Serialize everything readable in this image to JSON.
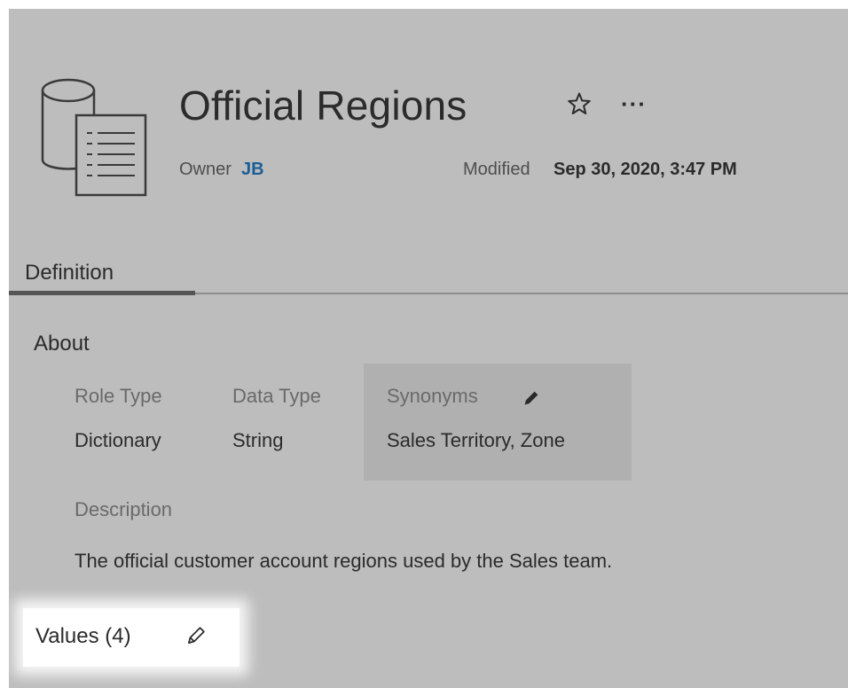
{
  "header": {
    "title": "Official Regions",
    "owner_label": "Owner",
    "owner_value": "JB",
    "modified_label": "Modified",
    "modified_value": "Sep 30, 2020, 3:47 PM",
    "icons": [
      "database-table-icon",
      "star-icon",
      "more-options-icon"
    ]
  },
  "tabs": [
    {
      "label": "Definition",
      "selected": true
    }
  ],
  "about": {
    "heading": "About",
    "role_type": {
      "label": "Role Type",
      "value": "Dictionary"
    },
    "data_type": {
      "label": "Data Type",
      "value": "String"
    },
    "synonyms": {
      "label": "Synonyms",
      "value": "Sales Territory, Zone",
      "edit_icon": "pencil-icon"
    },
    "description": {
      "label": "Description",
      "value": "The official customer account regions used by the Sales team."
    }
  },
  "values": {
    "label": "Values (4)",
    "edit_icon": "pencil-outline-icon"
  },
  "colors": {
    "background": "#bdbdbd",
    "owner_link": "#1b5e95",
    "highlight": "#ffffff"
  }
}
